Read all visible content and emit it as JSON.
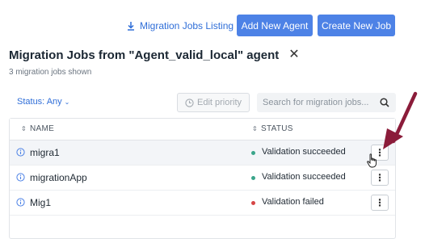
{
  "toolbar": {
    "listing_label": "Migration Jobs Listing",
    "add_agent_label": "Add New Agent",
    "create_job_label": "Create New Job"
  },
  "header": {
    "title": "Migration Jobs from \"Agent_valid_local\" agent",
    "close_glyph": "✕",
    "subtitle": "3 migration jobs shown"
  },
  "filters": {
    "status_label": "Status: Any",
    "status_chevron": "⌄",
    "edit_priority_label": "Edit priority",
    "search_placeholder": "Search for migration jobs..."
  },
  "table": {
    "columns": [
      "NAME",
      "STATUS"
    ],
    "sort_glyph": "⇕",
    "rows": [
      {
        "name": "migra1",
        "status": "Validation succeeded",
        "state": "success",
        "menu": "⋮"
      },
      {
        "name": "migrationApp",
        "status": "Validation succeeded",
        "state": "success",
        "menu": "⋮"
      },
      {
        "name": "Mig1",
        "status": "Validation failed",
        "state": "failed",
        "menu": "⋮"
      }
    ]
  },
  "colors": {
    "accent": "#4d82e6",
    "link": "#2f6ed8",
    "success": "#3aa58a",
    "failed": "#d64545",
    "annotation_arrow": "#8b1c3a"
  },
  "icons": {
    "listing": "download-icon",
    "edit_priority": "clock-icon",
    "search": "search-icon",
    "row_info": "info-icon",
    "row_menu": "kebab-menu-icon",
    "cursor": "hand-pointer-icon",
    "annotation": "arrow-icon"
  }
}
